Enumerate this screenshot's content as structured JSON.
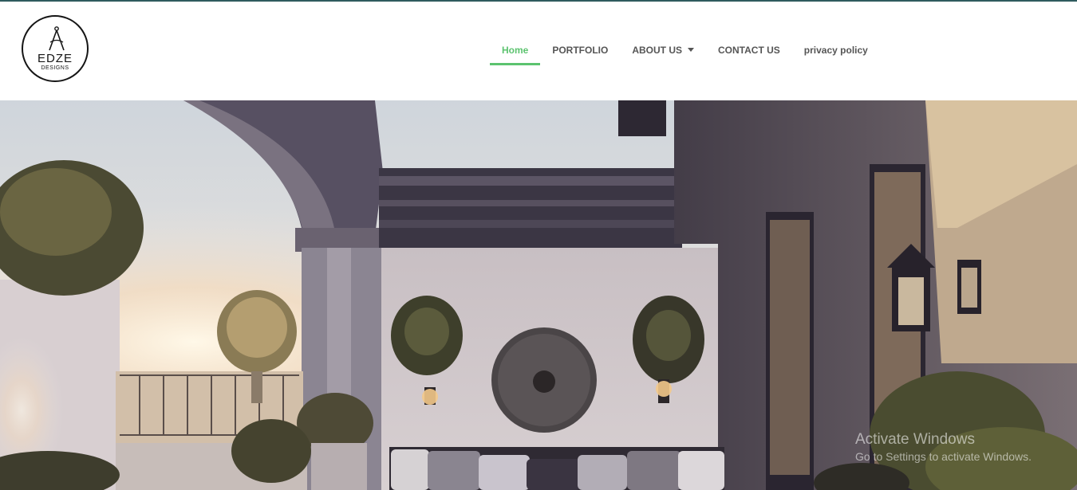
{
  "logo": {
    "name": "EDZE",
    "tagline": "DESIGNS"
  },
  "nav": {
    "items": [
      {
        "label": "Home",
        "active": true
      },
      {
        "label": "PORTFOLIO",
        "active": false
      },
      {
        "label": "ABOUT US",
        "active": false,
        "has_dropdown": true
      },
      {
        "label": "CONTACT US",
        "active": false
      },
      {
        "label": "privacy policy",
        "active": false
      }
    ],
    "active_color": "#5cc36f",
    "text_color": "#555555"
  },
  "hero": {
    "image_subject": "rooftop terrace lounge at sunset with potted topiary, wall lanterns and round wall medallion"
  },
  "os_watermark": {
    "title": "Activate Windows",
    "subtitle": "Go to Settings to activate Windows."
  },
  "colors": {
    "top_border": "#2f5b5e",
    "header_bg": "#ffffff"
  }
}
